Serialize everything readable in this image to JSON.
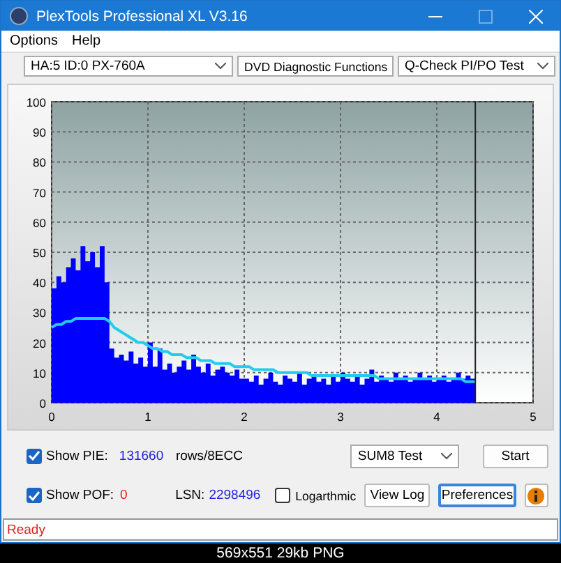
{
  "window": {
    "title": "PlexTools Professional XL V3.16"
  },
  "menu": [
    "Options",
    "Help"
  ],
  "selectors": [
    {
      "value": "HA:5 ID:0  PX-760A"
    },
    {
      "value": "DVD Diagnostic Functions"
    },
    {
      "value": "Q-Check PI/PO Test"
    }
  ],
  "chart_data": {
    "type": "area",
    "xlim": [
      0,
      5
    ],
    "ylim": [
      0,
      100
    ],
    "xticks": [
      0,
      1,
      2,
      3,
      4,
      5
    ],
    "yticks": [
      0,
      10,
      20,
      30,
      40,
      50,
      60,
      70,
      80,
      90,
      100
    ],
    "grid": true,
    "ref_lines": [
      {
        "axis": "x",
        "value": 4.4,
        "color": "#222222"
      }
    ],
    "x": [
      0,
      0.05,
      0.1,
      0.15,
      0.2,
      0.25,
      0.3,
      0.35,
      0.4,
      0.45,
      0.5,
      0.55,
      0.6,
      0.65,
      0.7,
      0.75,
      0.8,
      0.85,
      0.9,
      0.95,
      1,
      1.05,
      1.1,
      1.15,
      1.2,
      1.25,
      1.3,
      1.35,
      1.4,
      1.45,
      1.5,
      1.55,
      1.6,
      1.65,
      1.7,
      1.75,
      1.8,
      1.85,
      1.9,
      1.95,
      2,
      2.05,
      2.1,
      2.15,
      2.2,
      2.25,
      2.3,
      2.35,
      2.4,
      2.45,
      2.5,
      2.55,
      2.6,
      2.65,
      2.7,
      2.75,
      2.8,
      2.85,
      2.9,
      2.95,
      3,
      3.05,
      3.1,
      3.15,
      3.2,
      3.25,
      3.3,
      3.35,
      3.4,
      3.45,
      3.5,
      3.55,
      3.6,
      3.65,
      3.7,
      3.75,
      3.8,
      3.85,
      3.9,
      3.95,
      4,
      4.05,
      4.1,
      4.15,
      4.2,
      4.25,
      4.3,
      4.35,
      4.4
    ],
    "series": [
      {
        "type": "area",
        "color": "#0000ff",
        "values": [
          38,
          42,
          40,
          45,
          48,
          44,
          52,
          47,
          50,
          45,
          52,
          40,
          18,
          15,
          16,
          14,
          17,
          13,
          15,
          12,
          20,
          12,
          18,
          11,
          13,
          10,
          12,
          14,
          11,
          16,
          12,
          10,
          13,
          9,
          11,
          12,
          10,
          9,
          11,
          8,
          8,
          7,
          9,
          6,
          8,
          10,
          7,
          6,
          9,
          8,
          7,
          10,
          6,
          8,
          9,
          7,
          8,
          6,
          9,
          7,
          10,
          8,
          7,
          9,
          6,
          8,
          11,
          7,
          9,
          8,
          7,
          10,
          8,
          9,
          7,
          8,
          10,
          8,
          9,
          7,
          8,
          9,
          7,
          8,
          10,
          8,
          9,
          8,
          7
        ]
      },
      {
        "type": "line",
        "color": "#22ccee",
        "values": [
          25,
          26,
          26,
          27,
          27,
          28,
          28,
          28,
          28,
          28,
          28,
          28,
          27,
          25,
          24,
          23,
          22,
          21,
          20,
          20,
          19,
          18,
          18,
          17,
          17,
          16,
          16,
          16,
          15,
          15,
          15,
          14,
          14,
          14,
          13,
          13,
          13,
          13,
          12,
          12,
          12,
          12,
          11,
          11,
          11,
          11,
          11,
          10,
          10,
          10,
          10,
          10,
          10,
          10,
          9,
          9,
          9,
          9,
          9,
          9,
          9,
          9,
          9,
          9,
          9,
          9,
          9,
          9,
          8,
          8,
          8,
          8,
          8,
          8,
          8,
          8,
          8,
          8,
          8,
          8,
          8,
          8,
          8,
          8,
          8,
          8,
          7,
          7,
          7
        ]
      }
    ]
  },
  "controls": {
    "show_pie": {
      "label": "Show PIE:",
      "checked": true,
      "value": "131660",
      "unit": "rows/8ECC"
    },
    "show_pof": {
      "label": "Show POF:",
      "checked": true,
      "value": "0"
    },
    "lsn": {
      "label": "LSN:",
      "value": "2298496"
    },
    "logarithmic": {
      "label": "Logarthmic",
      "checked": false
    },
    "test_select": {
      "value": "SUM8 Test"
    },
    "buttons": [
      {
        "label": "Start",
        "focused": false
      },
      {
        "label": "View Log",
        "focused": false
      },
      {
        "label": "Preferences",
        "focused": true
      }
    ]
  },
  "status_bar": {
    "text": "Ready"
  },
  "caption": "569x551 29kb PNG"
}
